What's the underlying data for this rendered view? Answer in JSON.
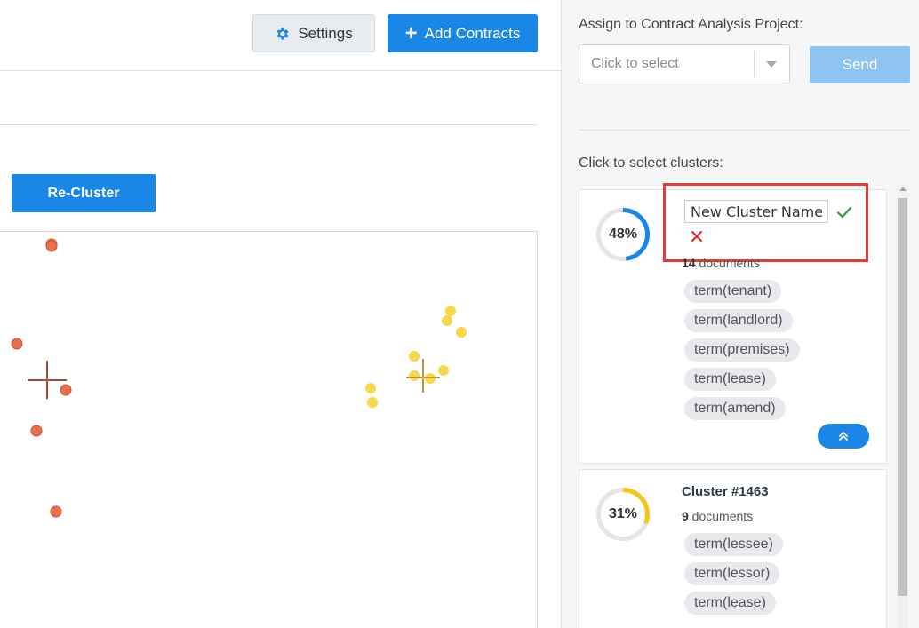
{
  "toolbar": {
    "settings_label": "Settings",
    "add_contracts_label": "Add Contracts"
  },
  "main": {
    "recluster_label": "Re-Cluster"
  },
  "panel": {
    "assign_label": "Assign to Contract Analysis Project:",
    "select_placeholder": "Click to select",
    "send_label": "Send",
    "clusters_label": "Click to select clusters:"
  },
  "clusters": [
    {
      "percent": 48,
      "percent_label": "48%",
      "ring_color": "#1a87e6",
      "name_input_value": "New Cluster Name",
      "doc_count": "14",
      "doc_suffix": " documents",
      "tags": [
        "term(tenant)",
        "term(landlord)",
        "term(premises)",
        "term(lease)",
        "term(amend)"
      ]
    },
    {
      "percent": 31,
      "percent_label": "31%",
      "ring_color": "#f5c518",
      "title": "Cluster #1463",
      "doc_count": "9",
      "doc_suffix": " documents",
      "tags": [
        "term(lessee)",
        "term(lessor)",
        "term(lease)"
      ]
    }
  ],
  "colors": {
    "accent": "#1a87e6",
    "highlight": "#e03c3c",
    "cluster_red": "#e8704f",
    "cluster_yellow": "#f7d84a"
  },
  "icons": {
    "settings": "gear-icon",
    "add": "plus-icon",
    "confirm": "check-icon",
    "cancel": "close-icon",
    "collapse": "chevron-double-up-icon",
    "dropdown": "caret-down-icon"
  }
}
